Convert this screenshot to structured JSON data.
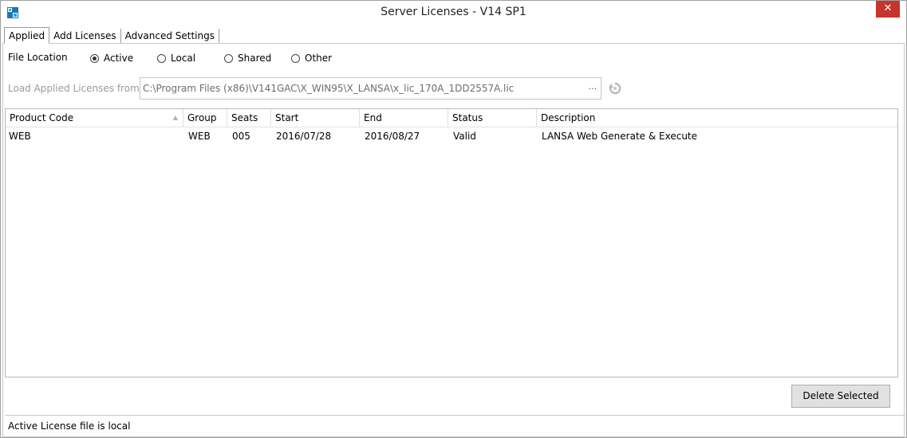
{
  "window": {
    "title": "Server Licenses - V14 SP1",
    "close_label": "✕",
    "icon": "app-grid-icon",
    "accent_color": "#c7342b"
  },
  "tabs": [
    {
      "label": "Applied",
      "active": true
    },
    {
      "label": "Add Licenses",
      "active": false
    },
    {
      "label": "Advanced Settings",
      "active": false
    }
  ],
  "file_location": {
    "label": "File Location",
    "options": [
      {
        "label": "Active",
        "checked": true
      },
      {
        "label": "Local",
        "checked": false
      },
      {
        "label": "Shared",
        "checked": false
      },
      {
        "label": "Other",
        "checked": false
      }
    ]
  },
  "load": {
    "label": "Load Applied Licenses from",
    "path": "C:\\Program Files (x86)\\V141GAC\\X_WIN95\\X_LANSA\\x_lic_170A_1DD2557A.lic",
    "browse_label": "...",
    "refresh_icon": "refresh-icon"
  },
  "grid": {
    "columns": [
      "Product Code",
      "Group",
      "Seats",
      "Start",
      "End",
      "Status",
      "Description"
    ],
    "sort_indicator": "▲",
    "rows": [
      {
        "cells": [
          "WEB",
          "WEB",
          "005",
          "2016/07/28",
          "2016/08/27",
          "Valid",
          "LANSA Web Generate & Execute"
        ]
      }
    ]
  },
  "actions": {
    "delete_label": "Delete Selected"
  },
  "status": {
    "text": "Active License file is local"
  }
}
